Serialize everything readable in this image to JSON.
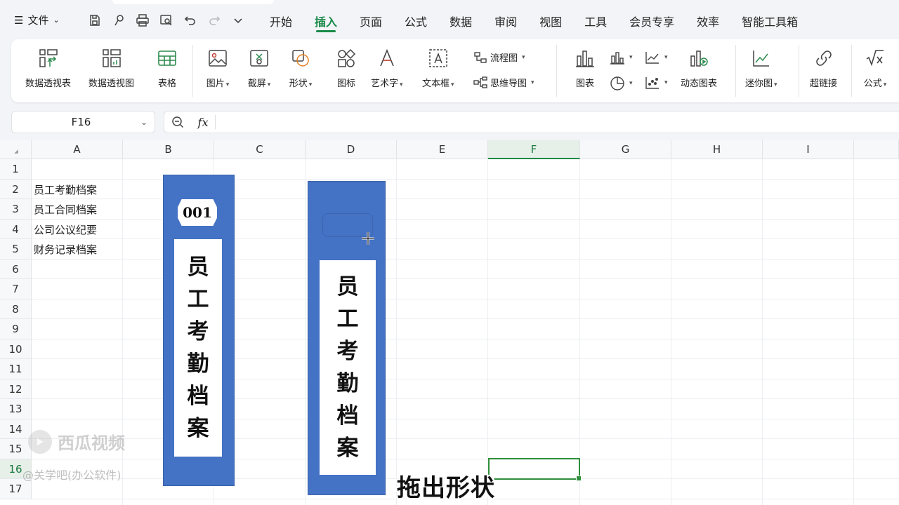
{
  "menu": {
    "file_label": "文件",
    "tabs": [
      "开始",
      "插入",
      "页面",
      "公式",
      "数据",
      "审阅",
      "视图",
      "工具",
      "会员专享",
      "效率",
      "智能工具箱"
    ],
    "active_tab": "插入"
  },
  "ribbon": {
    "pivot_table": "数据透视表",
    "pivot_chart": "数据透视图",
    "table": "表格",
    "picture": "图片",
    "screenshot": "截屏",
    "shape": "形状",
    "icon": "图标",
    "wordart": "艺术字",
    "textbox": "文本框",
    "flowchart": "流程图",
    "mindmap": "思维导图",
    "chart": "图表",
    "dynamic_chart": "动态图表",
    "sparkline": "迷你图",
    "hyperlink": "超链接",
    "formula": "公式"
  },
  "formula_bar": {
    "cell_ref": "F16",
    "fx": "fx",
    "content": ""
  },
  "sheet": {
    "columns": [
      "A",
      "B",
      "C",
      "D",
      "E",
      "F",
      "G",
      "H",
      "I"
    ],
    "selected_column": "F",
    "rows": [
      "1",
      "2",
      "3",
      "4",
      "5",
      "6",
      "7",
      "8",
      "9",
      "10",
      "11",
      "12",
      "13",
      "14",
      "15",
      "16",
      "17"
    ],
    "selected_row": "16",
    "cells": {
      "A2": "员工考勤档案",
      "A3": "员工合同档案",
      "A4": "公司公议纪要",
      "A5": "财务记录档案"
    }
  },
  "shapes": {
    "card1_number": "001",
    "card1_title_chars": [
      "员",
      "工",
      "考",
      "勤",
      "档",
      "案"
    ],
    "card2_title_chars": [
      "员",
      "工",
      "考",
      "勤",
      "档",
      "案"
    ]
  },
  "overlay": {
    "subtitle": "拖出形状",
    "watermark_platform": "西瓜视频",
    "watermark_author": "@关学吧(办公软件)"
  },
  "colors": {
    "accent_green": "#1a8a4a",
    "card_blue": "#4472c4",
    "selection_green": "#2f8f3d"
  }
}
